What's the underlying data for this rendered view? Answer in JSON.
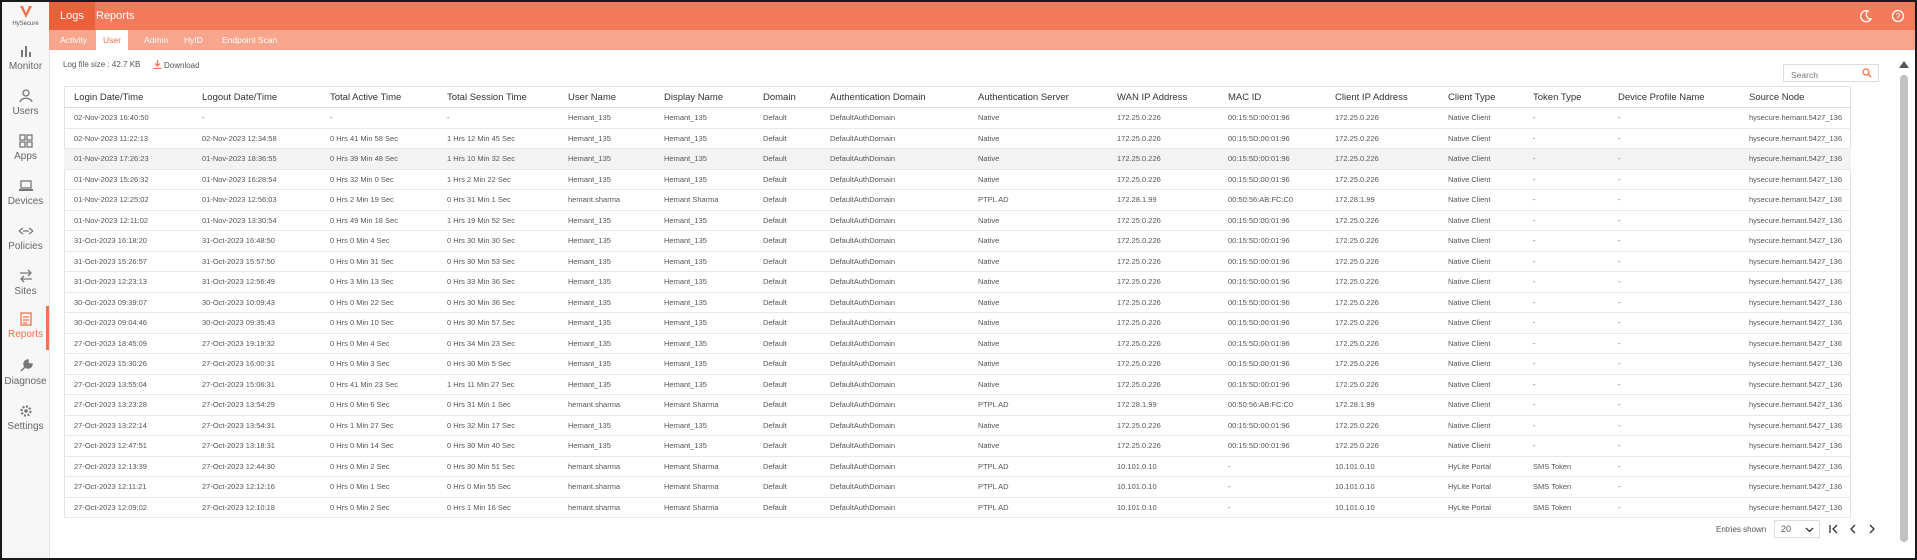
{
  "app": {
    "logo_text": "HySecure"
  },
  "sidebar": {
    "items": [
      {
        "label": "Monitor",
        "icon": "bar-chart-icon"
      },
      {
        "label": "Users",
        "icon": "user-icon"
      },
      {
        "label": "Apps",
        "icon": "apps-grid-icon"
      },
      {
        "label": "Devices",
        "icon": "laptop-icon"
      },
      {
        "label": "Policies",
        "icon": "policy-arrows-icon"
      },
      {
        "label": "Sites",
        "icon": "sites-arrows-icon"
      },
      {
        "label": "Reports",
        "icon": "report-icon",
        "active": true
      },
      {
        "label": "Diagnose",
        "icon": "wrench-icon"
      },
      {
        "label": "Settings",
        "icon": "gear-icon"
      }
    ]
  },
  "top_tabs": [
    "Logs",
    "Reports"
  ],
  "sub_tabs": [
    "Activity",
    "User",
    "Admin",
    "HyID",
    "Endpoint Scan"
  ],
  "toolbar": {
    "file_size": "Log file size : 42.7 KB",
    "download_label": "Download",
    "search_placeholder": "Search"
  },
  "table": {
    "columns": [
      "Login Date/Time",
      "Logout Date/Time",
      "Total Active Time",
      "Total Session Time",
      "User Name",
      "Display Name",
      "Domain",
      "Authentication Domain",
      "Authentication Server",
      "WAN IP Address",
      "MAC ID",
      "Client IP Address",
      "Client Type",
      "Token Type",
      "Device Profile Name",
      "Source Node"
    ],
    "rows": [
      [
        "02-Nov-2023 16:40:50",
        "-",
        "-",
        "-",
        "Hemant_135",
        "Hemant_135",
        "Default",
        "DefaultAuthDomain",
        "Native",
        "172.25.0.226",
        "00:15:5D:00:01:96",
        "172.25.0.226",
        "Native Client",
        "-",
        "-",
        "hysecure.hemant.5427_136"
      ],
      [
        "02-Nov-2023 11:22:13",
        "02-Nov-2023 12:34:58",
        "0 Hrs 41 Min 58 Sec",
        "1 Hrs 12 Min 45 Sec",
        "Hemant_135",
        "Hemant_135",
        "Default",
        "DefaultAuthDomain",
        "Native",
        "172.25.0.226",
        "00:15:5D:00:01:96",
        "172.25.0.226",
        "Native Client",
        "-",
        "-",
        "hysecure.hemant.5427_136"
      ],
      [
        "01-Nov-2023 17:26:23",
        "01-Nov-2023 18:36:55",
        "0 Hrs 39 Min 48 Sec",
        "1 Hrs 10 Min 32 Sec",
        "Hemant_135",
        "Hemant_135",
        "Default",
        "DefaultAuthDomain",
        "Native",
        "172.25.0.226",
        "00:15:5D:00:01:96",
        "172.25.0.226",
        "Native Client",
        "-",
        "-",
        "hysecure.hemant.5427_136"
      ],
      [
        "01-Nov-2023 15:26:32",
        "01-Nov-2023 16:28:54",
        "0 Hrs 32 Min 0 Sec",
        "1 Hrs 2 Min 22 Sec",
        "Hemant_135",
        "Hemant_135",
        "Default",
        "DefaultAuthDomain",
        "Native",
        "172.25.0.226",
        "00:15:5D:00:01:96",
        "172.25.0.226",
        "Native Client",
        "-",
        "-",
        "hysecure.hemant.5427_136"
      ],
      [
        "01-Nov-2023 12:25:02",
        "01-Nov-2023 12:56:03",
        "0 Hrs 2 Min 19 Sec",
        "0 Hrs 31 Min 1 Sec",
        "hemant.sharma",
        "Hemant Sharma",
        "Default",
        "DefaultAuthDomain",
        "PTPL AD",
        "172.28.1.99",
        "00:50:56:AB:FC:C0",
        "172.28.1.99",
        "Native Client",
        "-",
        "-",
        "hysecure.hemant.5427_136"
      ],
      [
        "01-Nov-2023 12:11:02",
        "01-Nov-2023 13:30:54",
        "0 Hrs 49 Min 18 Sec",
        "1 Hrs 19 Min 52 Sec",
        "Hemant_135",
        "Hemant_135",
        "Default",
        "DefaultAuthDomain",
        "Native",
        "172.25.0.226",
        "00:15:5D:00:01:96",
        "172.25.0.226",
        "Native Client",
        "-",
        "-",
        "hysecure.hemant.5427_136"
      ],
      [
        "31-Oct-2023 16:18:20",
        "31-Oct-2023 16:48:50",
        "0 Hrs 0 Min 4 Sec",
        "0 Hrs 30 Min 30 Sec",
        "Hemant_135",
        "Hemant_135",
        "Default",
        "DefaultAuthDomain",
        "Native",
        "172.25.0.226",
        "00:15:5D:00:01:96",
        "172.25.0.226",
        "Native Client",
        "-",
        "-",
        "hysecure.hemant.5427_136"
      ],
      [
        "31-Oct-2023 15:26:57",
        "31-Oct-2023 15:57:50",
        "0 Hrs 0 Min 31 Sec",
        "0 Hrs 30 Min 53 Sec",
        "Hemant_135",
        "Hemant_135",
        "Default",
        "DefaultAuthDomain",
        "Native",
        "172.25.0.226",
        "00:15:5D:00:01:96",
        "172.25.0.226",
        "Native Client",
        "-",
        "-",
        "hysecure.hemant.5427_136"
      ],
      [
        "31-Oct-2023 12:23:13",
        "31-Oct-2023 12:56:49",
        "0 Hrs 3 Min 13 Sec",
        "0 Hrs 33 Min 36 Sec",
        "Hemant_135",
        "Hemant_135",
        "Default",
        "DefaultAuthDomain",
        "Native",
        "172.25.0.226",
        "00:15:5D:00:01:96",
        "172.25.0.226",
        "Native Client",
        "-",
        "-",
        "hysecure.hemant.5427_136"
      ],
      [
        "30-Oct-2023 09:39:07",
        "30-Oct-2023 10:09:43",
        "0 Hrs 0 Min 22 Sec",
        "0 Hrs 30 Min 36 Sec",
        "Hemant_135",
        "Hemant_135",
        "Default",
        "DefaultAuthDomain",
        "Native",
        "172.25.0.226",
        "00:15:5D:00:01:96",
        "172.25.0.226",
        "Native Client",
        "-",
        "-",
        "hysecure.hemant.5427_136"
      ],
      [
        "30-Oct-2023 09:04:46",
        "30-Oct-2023 09:35:43",
        "0 Hrs 0 Min 10 Sec",
        "0 Hrs 30 Min 57 Sec",
        "Hemant_135",
        "Hemant_135",
        "Default",
        "DefaultAuthDomain",
        "Native",
        "172.25.0.226",
        "00:15:5D:00:01:96",
        "172.25.0.226",
        "Native Client",
        "-",
        "-",
        "hysecure.hemant.5427_136"
      ],
      [
        "27-Oct-2023 18:45:09",
        "27-Oct-2023 19:19:32",
        "0 Hrs 0 Min 4 Sec",
        "0 Hrs 34 Min 23 Sec",
        "Hemant_135",
        "Hemant_135",
        "Default",
        "DefaultAuthDomain",
        "Native",
        "172.25.0.226",
        "00:15:5D:00:01:96",
        "172.25.0.226",
        "Native Client",
        "-",
        "-",
        "hysecure.hemant.5427_136"
      ],
      [
        "27-Oct-2023 15:30:26",
        "27-Oct-2023 16:00:31",
        "0 Hrs 0 Min 3 Sec",
        "0 Hrs 30 Min 5 Sec",
        "Hemant_135",
        "Hemant_135",
        "Default",
        "DefaultAuthDomain",
        "Native",
        "172.25.0.226",
        "00:15:5D:00:01:96",
        "172.25.0.226",
        "Native Client",
        "-",
        "-",
        "hysecure.hemant.5427_136"
      ],
      [
        "27-Oct-2023 13:55:04",
        "27-Oct-2023 15:06:31",
        "0 Hrs 41 Min 23 Sec",
        "1 Hrs 11 Min 27 Sec",
        "Hemant_135",
        "Hemant_135",
        "Default",
        "DefaultAuthDomain",
        "Native",
        "172.25.0.226",
        "00:15:5D:00:01:96",
        "172.25.0.226",
        "Native Client",
        "-",
        "-",
        "hysecure.hemant.5427_136"
      ],
      [
        "27-Oct-2023 13:23:28",
        "27-Oct-2023 13:54:29",
        "0 Hrs 0 Min 6 Sec",
        "0 Hrs 31 Min 1 Sec",
        "hemant.sharma",
        "Hemant Sharma",
        "Default",
        "DefaultAuthDomain",
        "PTPL AD",
        "172.28.1.99",
        "00:50:56:AB:FC:C0",
        "172.28.1.99",
        "Native Client",
        "-",
        "-",
        "hysecure.hemant.5427_136"
      ],
      [
        "27-Oct-2023 13:22:14",
        "27-Oct-2023 13:54:31",
        "0 Hrs 1 Min 27 Sec",
        "0 Hrs 32 Min 17 Sec",
        "Hemant_135",
        "Hemant_135",
        "Default",
        "DefaultAuthDomain",
        "Native",
        "172.25.0.226",
        "00:15:5D:00:01:96",
        "172.25.0.226",
        "Native Client",
        "-",
        "-",
        "hysecure.hemant.5427_136"
      ],
      [
        "27-Oct-2023 12:47:51",
        "27-Oct-2023 13:18:31",
        "0 Hrs 0 Min 14 Sec",
        "0 Hrs 30 Min 40 Sec",
        "Hemant_135",
        "Hemant_135",
        "Default",
        "DefaultAuthDomain",
        "Native",
        "172.25.0.226",
        "00:15:5D:00:01:96",
        "172.25.0.226",
        "Native Client",
        "-",
        "-",
        "hysecure.hemant.5427_136"
      ],
      [
        "27-Oct-2023 12:13:39",
        "27-Oct-2023 12:44:30",
        "0 Hrs 0 Min 2 Sec",
        "0 Hrs 30 Min 51 Sec",
        "hemant.sharma",
        "Hemant Sharma",
        "Default",
        "DefaultAuthDomain",
        "PTPL AD",
        "10.101.0.10",
        "-",
        "10.101.0.10",
        "HyLite Portal",
        "SMS Token",
        "-",
        "hysecure.hemant.5427_136"
      ],
      [
        "27-Oct-2023 12:11:21",
        "27-Oct-2023 12:12:16",
        "0 Hrs 0 Min 1 Sec",
        "0 Hrs 0 Min 55 Sec",
        "hemant.sharma",
        "Hemant Sharma",
        "Default",
        "DefaultAuthDomain",
        "PTPL AD",
        "10.101.0.10",
        "-",
        "10.101.0.10",
        "HyLite Portal",
        "SMS Token",
        "-",
        "hysecure.hemant.5427_136"
      ],
      [
        "27-Oct-2023 12:09:02",
        "27-Oct-2023 12:10:18",
        "0 Hrs 0 Min 2 Sec",
        "0 Hrs 1 Min 16 Sec",
        "hemant.sharma",
        "Hemant Sharma",
        "Default",
        "DefaultAuthDomain",
        "PTPL AD",
        "10.101.0.10",
        "-",
        "10.101.0.10",
        "HyLite Portal",
        "SMS Token",
        "-",
        "hysecure.hemant.5427_136"
      ]
    ]
  },
  "pagination": {
    "label": "Entries shown",
    "page_size": "20"
  },
  "colors": {
    "accent": "#f4714a",
    "topbar": "#f47a5c",
    "subbar": "#f8a58d",
    "active_tab": "#e9603a"
  }
}
